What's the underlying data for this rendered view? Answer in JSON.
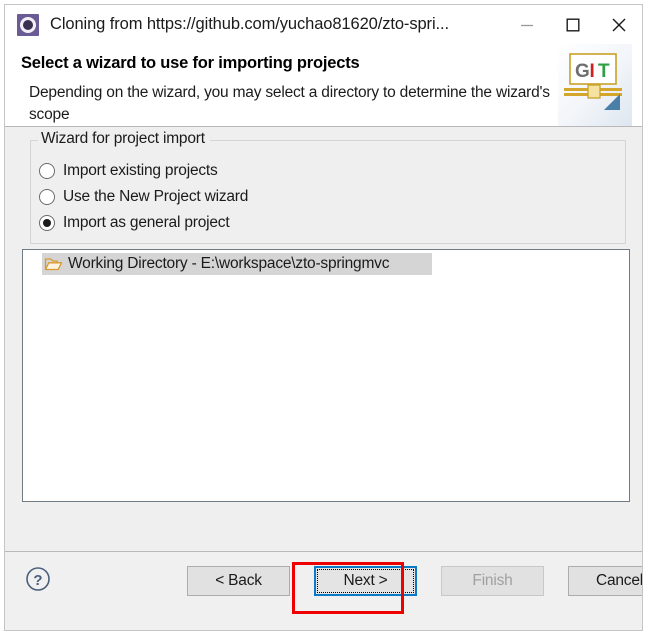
{
  "window": {
    "title": "Cloning from https://github.com/yuchao81620/zto-spri...",
    "app_icon": "eclipse-git-icon",
    "controls": {
      "minimize": "minimize-icon",
      "maximize": "maximize-icon",
      "close": "close-icon"
    }
  },
  "header": {
    "title": "Select a wizard to use for importing projects",
    "description": "Depending on the wizard, you may select a directory to determine the wizard's scope",
    "logo": {
      "name": "git-logo",
      "letters": [
        "G",
        "I",
        "T"
      ],
      "colors": {
        "g": "#6f6f6f",
        "i": "#cc2222",
        "t": "#2f9e44",
        "band": "#d4a72c",
        "triangle": "#4a7fa8"
      }
    }
  },
  "wizard_group": {
    "legend": "Wizard for project import",
    "options": [
      {
        "label": "Import existing projects",
        "selected": false
      },
      {
        "label": "Use the New Project wizard",
        "selected": false
      },
      {
        "label": "Import as general project",
        "selected": true
      }
    ]
  },
  "tree": {
    "items": [
      {
        "icon": "open-folder-icon",
        "label": "Working Directory - E:\\workspace\\zto-springmvc",
        "selected": true
      }
    ]
  },
  "footer": {
    "help": "help-icon",
    "buttons": [
      {
        "label": "< Back",
        "state": "enabled"
      },
      {
        "label": "Next >",
        "state": "focused"
      },
      {
        "label": "Finish",
        "state": "disabled"
      },
      {
        "label": "Cancel",
        "state": "enabled"
      }
    ]
  },
  "annotations": {
    "accent_color": "#ee0000",
    "highlight_radio": "Import as general project",
    "highlight_button": "Next >"
  }
}
